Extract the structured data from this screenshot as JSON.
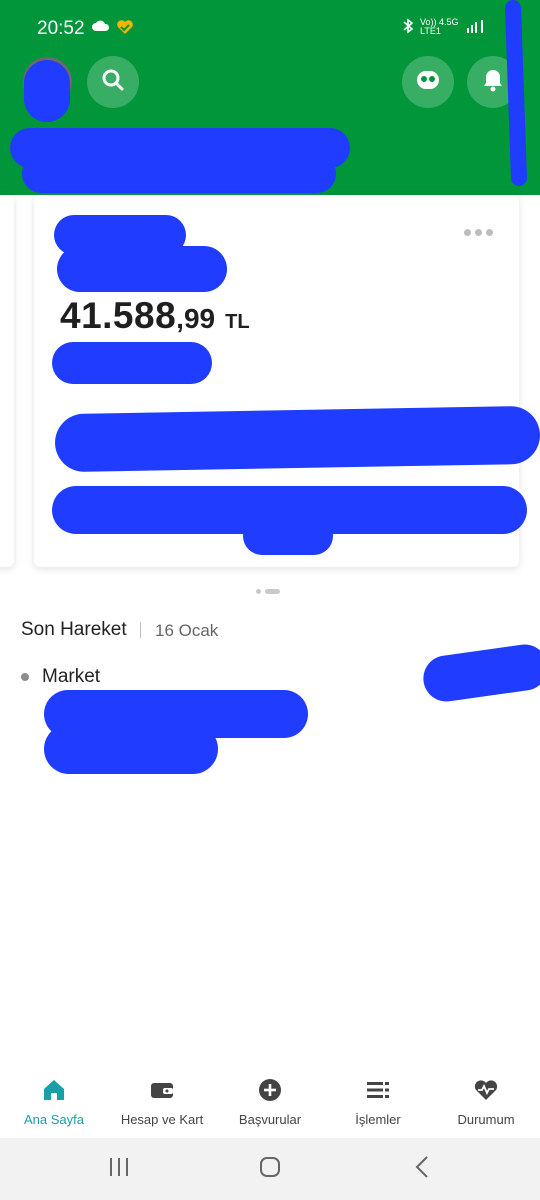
{
  "status_bar": {
    "time": "20:52",
    "network_top": "Vo)) 4.5G",
    "network_bottom": "LTE1",
    "icons": [
      "cloud-icon",
      "heart-app-icon",
      "bluetooth-icon",
      "signal-icon"
    ]
  },
  "header": {
    "buttons": [
      "search-icon",
      "chatbot-icon",
      "notification-bell-icon"
    ],
    "color": "#009639"
  },
  "account_card": {
    "balance_integer": "41.588",
    "balance_decimal": ",99",
    "currency": "TL"
  },
  "recent_activity": {
    "title": "Son Hareket",
    "date": "16 Ocak",
    "items": [
      {
        "label": "Market"
      }
    ]
  },
  "tab_bar": {
    "active_color": "#1a9fa6",
    "tabs": [
      {
        "label": "Ana Sayfa",
        "icon": "home-icon",
        "active": true
      },
      {
        "label": "Hesap ve Kart",
        "icon": "wallet-icon",
        "active": false
      },
      {
        "label": "Başvurular",
        "icon": "plus-circle-icon",
        "active": false
      },
      {
        "label": "İşlemler",
        "icon": "list-icon",
        "active": false
      },
      {
        "label": "Durumum",
        "icon": "heart-pulse-icon",
        "active": false
      }
    ]
  },
  "system_nav": [
    "recents-icon",
    "home-circle-icon",
    "back-icon"
  ]
}
